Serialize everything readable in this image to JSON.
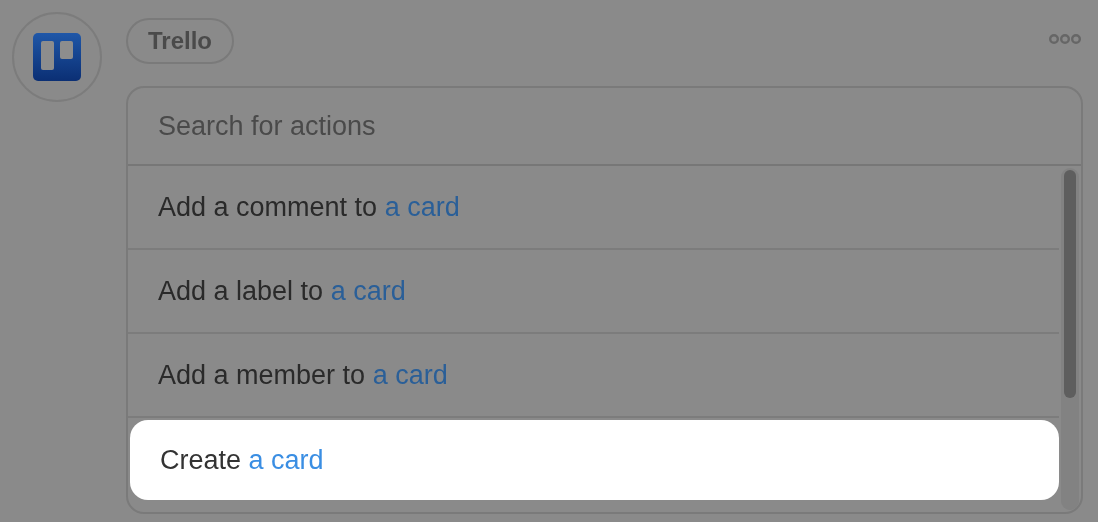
{
  "app": {
    "name": "Trello"
  },
  "search": {
    "placeholder": "Search for actions"
  },
  "actions": [
    {
      "label": "Add a comment to",
      "object": "a card",
      "selected": false
    },
    {
      "label": "Add a label to",
      "object": "a card",
      "selected": false
    },
    {
      "label": "Add a member to",
      "object": "a card",
      "selected": false
    },
    {
      "label": "Create",
      "object": "a card",
      "selected": true
    }
  ]
}
